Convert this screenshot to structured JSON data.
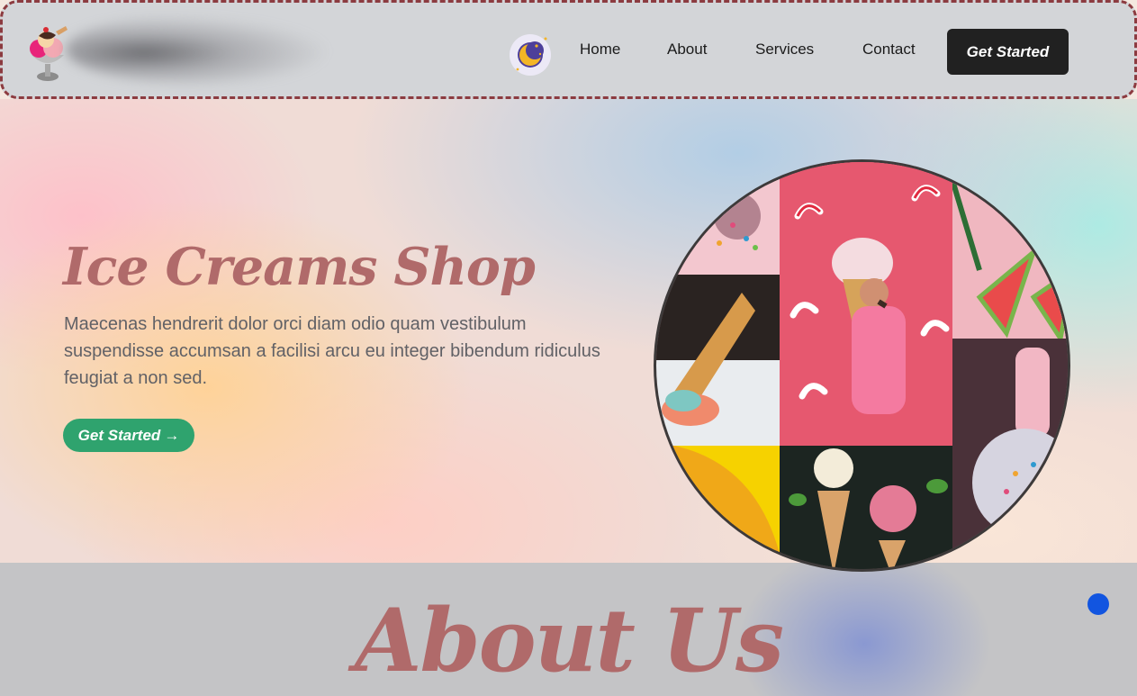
{
  "header": {
    "logo_icon": "ice-cream-sundae-logo",
    "theme_icon": "moon-stars-icon",
    "nav": [
      {
        "label": "Home"
      },
      {
        "label": "About"
      },
      {
        "label": "Services"
      },
      {
        "label": "Contact"
      }
    ],
    "cta_label": "Get Started"
  },
  "hero": {
    "title": "Ice Creams Shop",
    "description": "Maecenas hendrerit dolor orci diam odio quam vestibulum suspendisse accumsan a facilisi arcu eu integer bibendum ridiculus feugiat a non sed.",
    "cta_label": "Get Started",
    "cta_arrow": "→",
    "collage_tiles": [
      "sprinkles",
      "candy-canes-ice-cream-cone",
      "watermelon",
      "melting-cone",
      "man-with-ice-cream",
      "strawberry-popsicle",
      "yellow-background",
      "ice-cream-scoops-and-cones",
      "sprinkled-ice-cream-cup"
    ]
  },
  "about": {
    "title": "About Us"
  },
  "colors": {
    "header_bg": "#d3d5d8",
    "header_border": "#8c3b40",
    "title_color": "#b06a6a",
    "cta_dark": "#212121",
    "cta_green": "#2fa36e",
    "scroll_dot": "#1255e0"
  }
}
